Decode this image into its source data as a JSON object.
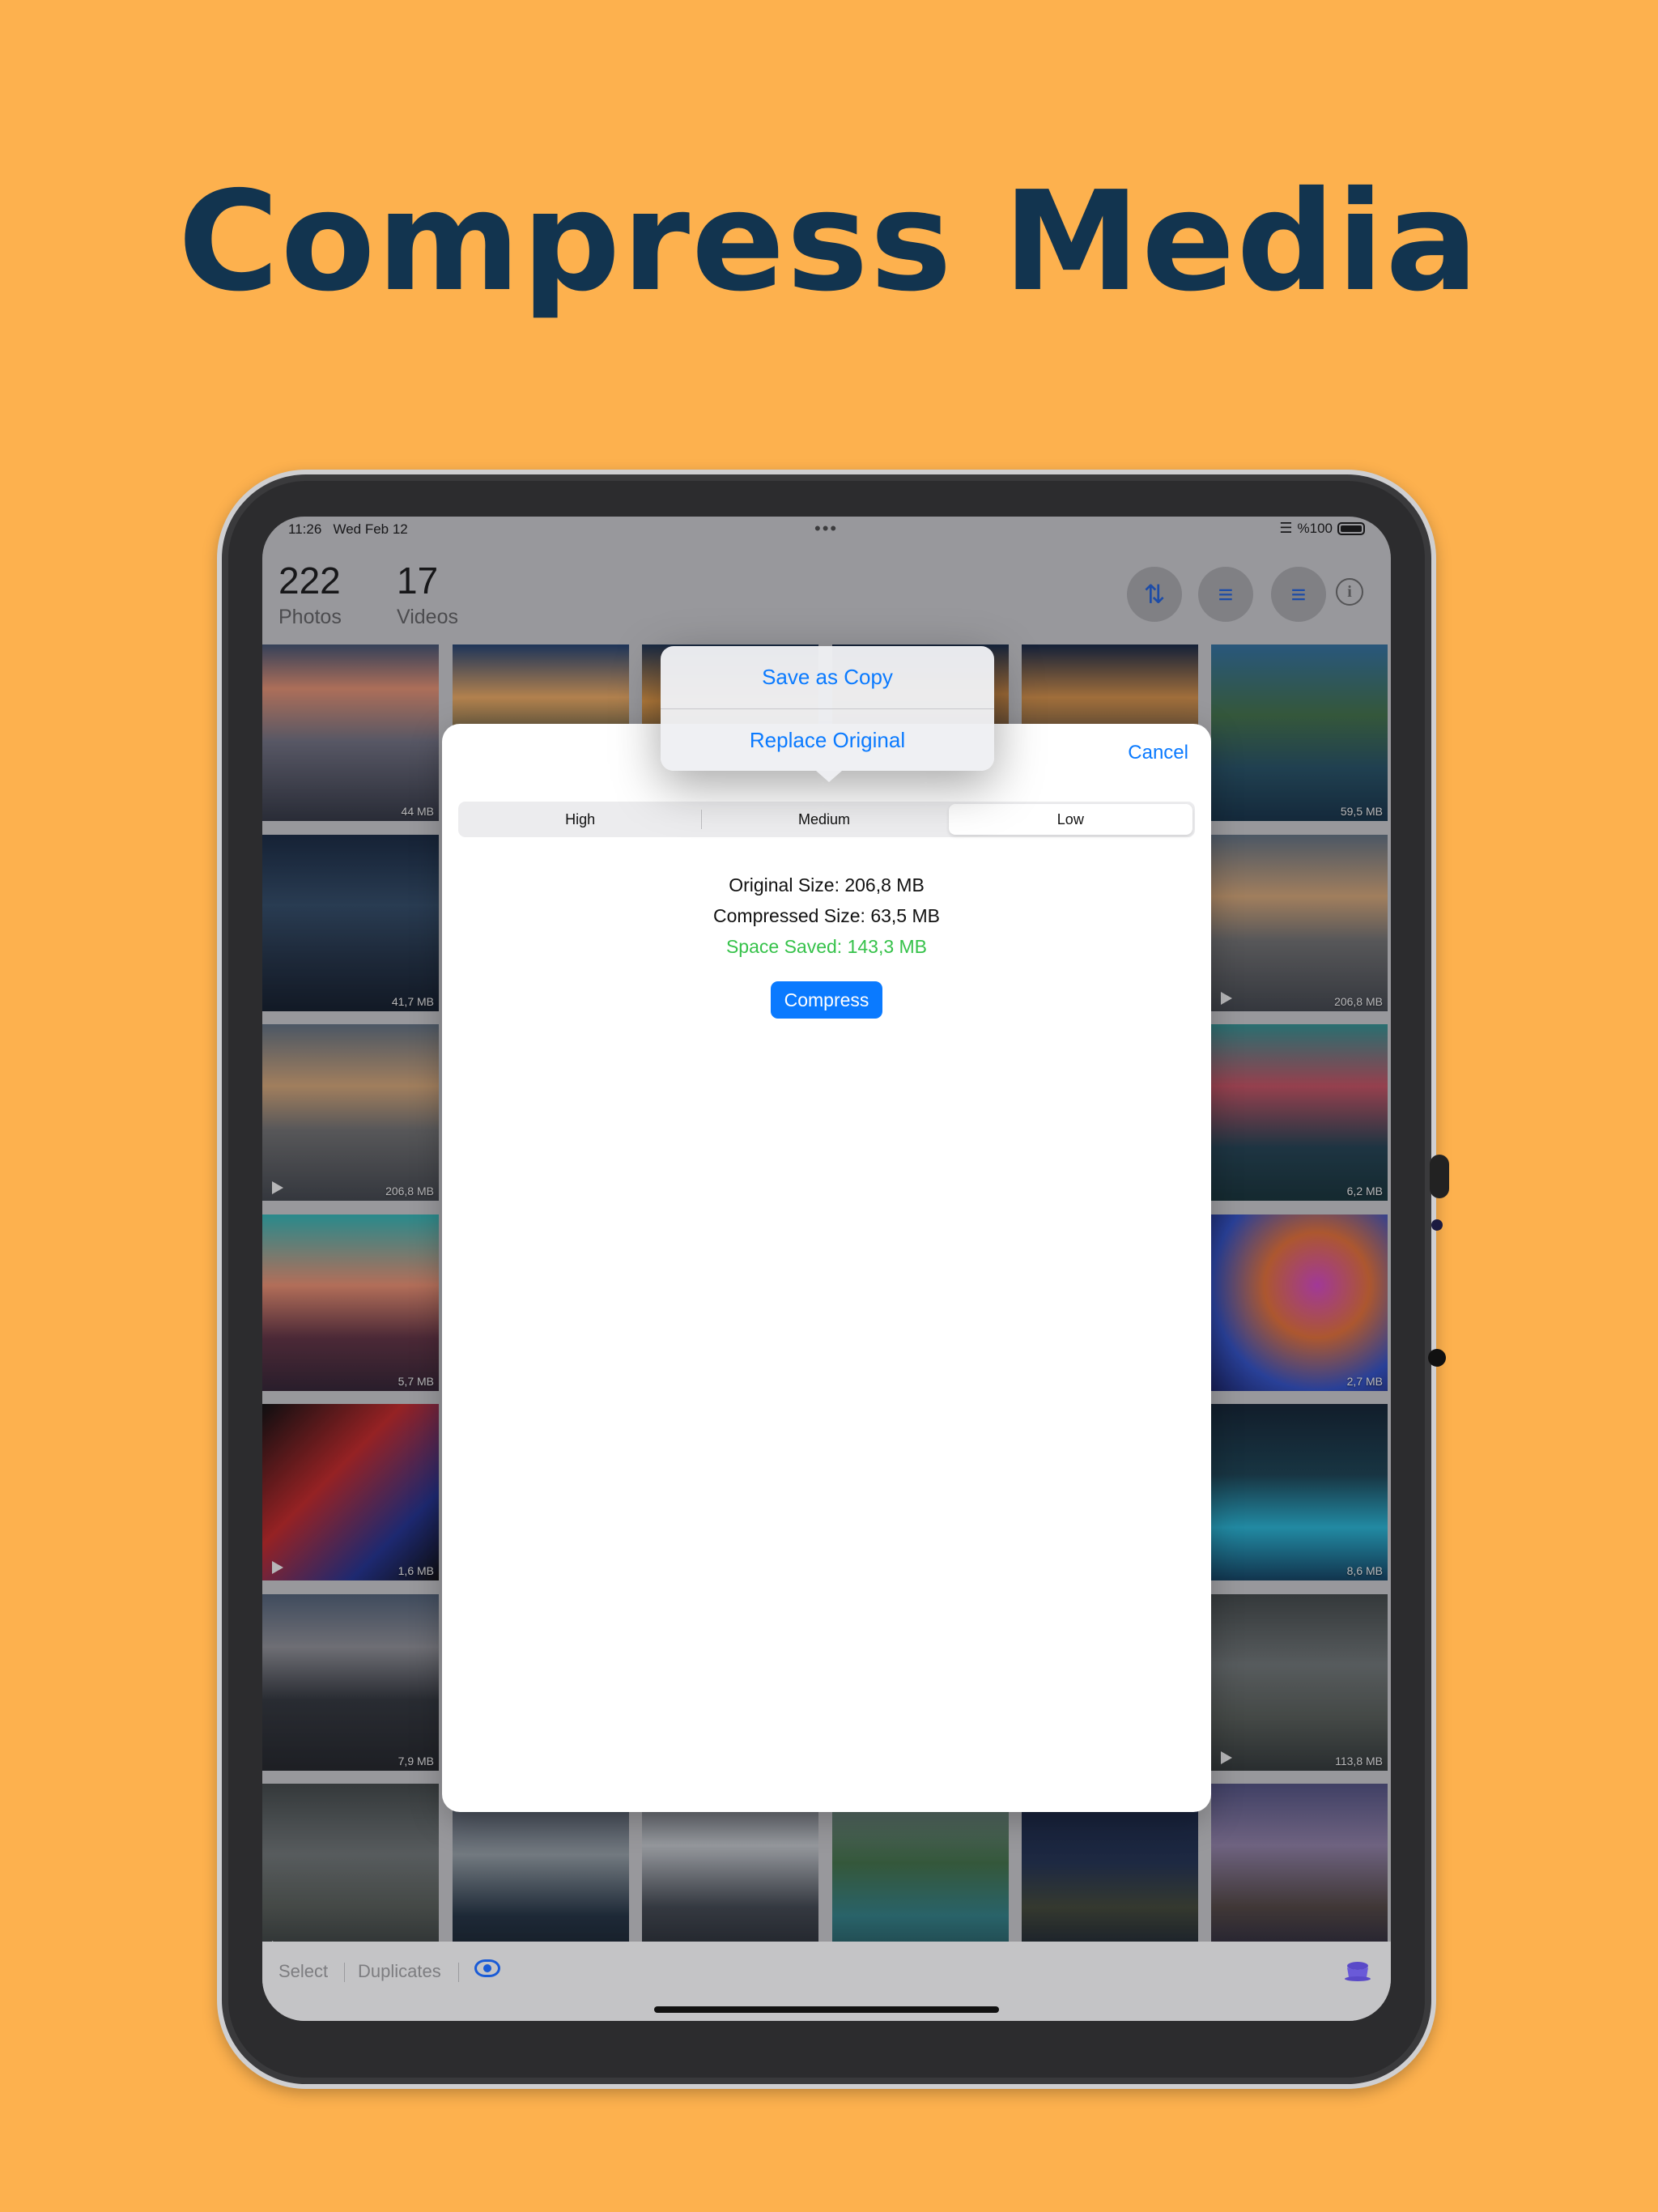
{
  "headline": "Compress Media",
  "status_bar": {
    "time": "11:26",
    "date": "Wed Feb 12",
    "battery": "%100",
    "menu_dots": "•••"
  },
  "header": {
    "photos_count": "222",
    "photos_label": "Photos",
    "videos_count": "17",
    "videos_label": "Videos",
    "icons": [
      "sort-icon",
      "filter-icon",
      "filter-icon",
      "info-icon"
    ]
  },
  "grid": {
    "tiles": [
      {
        "size": "44 MB",
        "video": false,
        "bg": "linear-gradient(180deg,#3a4b6a 0%,#e08a6a 25%,#6a6a7a 55%,#2a2e3a 100%)"
      },
      {
        "size": "",
        "video": false,
        "bg": "linear-gradient(180deg,#1a3a6a 0%,#e8a45a 30%,#3a4a3a 60%,#20303a 100%)"
      },
      {
        "size": "",
        "video": false,
        "bg": "linear-gradient(180deg,#132a4a 0%,#e89a40 32%,#2a3a3a 70%,#101a28 100%)"
      },
      {
        "size": "",
        "video": false,
        "bg": "linear-gradient(180deg,#0e2240 0%,#c8823a 28%,#24303a 70%,#0c1620 100%)"
      },
      {
        "size": "",
        "video": false,
        "bg": "linear-gradient(180deg,#0d1e3c 0%,#d08a40 30%,#2a3438 70%,#0d1822 100%)"
      },
      {
        "size": "59,5 MB",
        "video": false,
        "bg": "linear-gradient(180deg,#2a6a9a 0%,#3a6a40 40%,#1e4a5e 70%,#0d2a40 100%)"
      },
      {
        "size": "41,7 MB",
        "video": false,
        "bg": "linear-gradient(180deg,#0f2038 0%,#2a4460 40%,#1a2a3e 70%,#0a1422 100%)"
      },
      {
        "size": "206,8 MB",
        "video": true,
        "bg": "linear-gradient(180deg,#5a6a7a 0%,#d0a070 35%,#6a6a6a 60%,#3a3e44 100%)"
      },
      {
        "size": "206,8 MB",
        "video": true,
        "bg": "linear-gradient(180deg,#5a6a7a 0%,#d0a070 35%,#6a6a6a 60%,#3a3e44 100%)"
      },
      {
        "size": "6,2 MB",
        "video": false,
        "bg": "linear-gradient(180deg,#2a8a8a 0%,#c04a5a 35%,#1a3a4a 70%,#0e2a30 100%)"
      },
      {
        "size": "5,7 MB",
        "video": false,
        "bg": "linear-gradient(180deg,#2ab0b0 0%,#e88a6a 40%,#5a2a3a 70%,#2a1a2a 100%)"
      },
      {
        "size": "2,7 MB",
        "video": false,
        "bg": "radial-gradient(circle at 60% 40%,#d040c0 0%,#e06a30 35%,#2a4ac0 70%,#101a60 100%)"
      },
      {
        "size": "1,6 MB",
        "video": true,
        "bg": "linear-gradient(135deg,#050505 0%,#c02020 40%,#1a2a8a 75%,#050505 100%)"
      },
      {
        "size": "8,6 MB",
        "video": false,
        "bg": "linear-gradient(180deg,#0a1a2a 0%,#123a4a 40%,#20b0d0 70%,#0a3a5a 100%)"
      },
      {
        "size": "7,9 MB",
        "video": false,
        "bg": "linear-gradient(180deg,#4a5a70 0%,#8a8a90 30%,#2a2e34 60%,#1a1c20 100%)"
      },
      {
        "size": "113,8 MB",
        "video": true,
        "bg": "linear-gradient(180deg,#3a4040 0%,#6a7070 40%,#505650 70%,#2a3030 100%)"
      },
      {
        "size": "",
        "video": true,
        "bg": "linear-gradient(180deg,#3a4040 0%,#6a7070 40%,#505650 70%,#2a3030 100%)"
      },
      {
        "size": "",
        "video": false,
        "bg": "linear-gradient(180deg,#30384a 0%,#909aa0 40%,#1a2a3a 75%,#0d1620 100%)"
      },
      {
        "size": "",
        "video": false,
        "bg": "linear-gradient(180deg,#4a5058 0%,#c0c4c8 35%,#3a4048 70%,#1a1e24 100%)"
      },
      {
        "size": "",
        "video": false,
        "bg": "linear-gradient(180deg,#7a8a90 0%,#3a6a40 45%,#2a7a80 75%,#1a4a50 100%)"
      },
      {
        "size": "",
        "video": false,
        "bg": "linear-gradient(180deg,#0d1a3a 0%,#1a2a4a 45%,#3a4030 70%,#0a1426 100%)"
      },
      {
        "size": "",
        "video": false,
        "bg": "linear-gradient(180deg,#4a4a7a 0%,#8a7aa0 35%,#4a3e3a 70%,#1a1a30 100%)"
      }
    ]
  },
  "sheet": {
    "cancel_label": "Cancel",
    "quality_options": [
      "High",
      "Medium",
      "Low"
    ],
    "selected_quality": "Low",
    "original_size": "Original Size: 206,8 MB",
    "compressed_size": "Compressed Size: 63,5 MB",
    "space_saved": "Space Saved: 143,3 MB",
    "compress_label": "Compress"
  },
  "popover": {
    "save_copy": "Save as Copy",
    "replace_original": "Replace Original"
  },
  "toolbar": {
    "select_label": "Select",
    "duplicates_label": "Duplicates"
  },
  "colors": {
    "background": "#FDB14E",
    "headline": "#12344F",
    "accent": "#0A7AFF",
    "saved": "#36C24A"
  }
}
